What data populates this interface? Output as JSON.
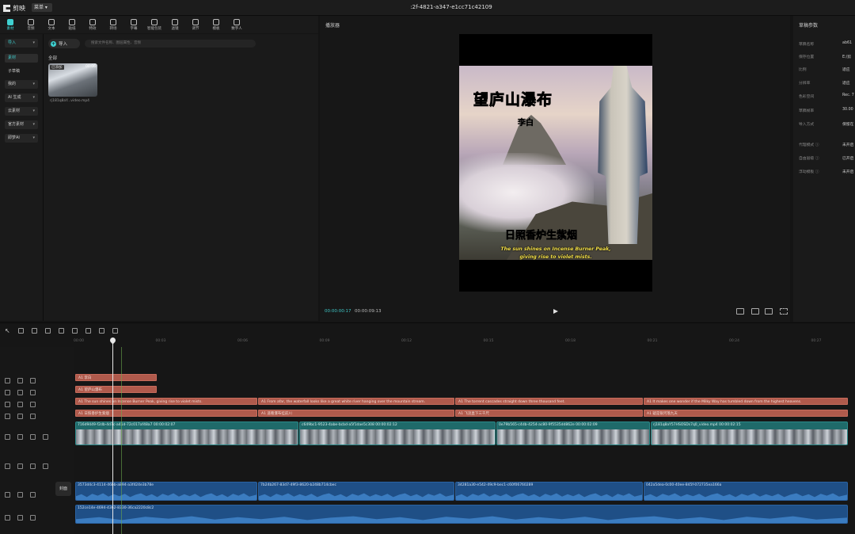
{
  "app": {
    "name": "剪映",
    "menu_label": "菜单",
    "doc_title": ":2f-4821-a347-e1cc71c42109"
  },
  "toolbar": {
    "items": [
      {
        "label": "素材",
        "icon": "media-icon"
      },
      {
        "label": "音频",
        "icon": "audio-icon"
      },
      {
        "label": "文本",
        "icon": "text-icon"
      },
      {
        "label": "贴纸",
        "icon": "sticker-icon"
      },
      {
        "label": "特效",
        "icon": "effects-icon"
      },
      {
        "label": "转场",
        "icon": "transition-icon"
      },
      {
        "label": "字幕",
        "icon": "subtitle-icon"
      },
      {
        "label": "智能包装",
        "icon": "smart-pack-icon"
      },
      {
        "label": "滤镜",
        "icon": "filter-icon"
      },
      {
        "label": "调节",
        "icon": "adjust-icon"
      },
      {
        "label": "模板",
        "icon": "template-icon"
      },
      {
        "label": "数字人",
        "icon": "avatar-icon"
      }
    ]
  },
  "leftnav": {
    "items": [
      "导入",
      "素材",
      "子草稿",
      "我的",
      "AI 生成",
      "云素材",
      "官方素材",
      "即梦AI"
    ]
  },
  "media": {
    "import_label": "导入",
    "search_placeholder": "搜索文件名称、图层属性、音频",
    "all_label": "全部",
    "thumb_tag": "已添加",
    "thumb_duration": "00:06",
    "thumb_name": "rj181q8aY...video.mp4"
  },
  "player": {
    "title": "播放器",
    "timecode": "00:00:00:17",
    "duration": "00:00:09:13",
    "title_cn": "望庐山瀑布",
    "author_cn": "李白",
    "subtitle_cn": "日照香炉生紫烟",
    "subtitle_en_1": "The sun shines on Incense Burner Peak,",
    "subtitle_en_2": "giving rise to violet mists."
  },
  "props": {
    "title": "草稿参数",
    "rows": [
      {
        "label": "草稿名称",
        "value": "ab61"
      },
      {
        "label": "保存位置",
        "value": "E:/剪"
      },
      {
        "label": "比例",
        "value": "适应"
      },
      {
        "label": "分辨率",
        "value": "适应"
      },
      {
        "label": "色彩空间",
        "value": "Rec. 7"
      },
      {
        "label": "草稿帧率",
        "value": "30.00"
      },
      {
        "label": "导入方式",
        "value": "保留在"
      },
      {
        "label": "代理模式 ⓘ",
        "value": "未开启"
      },
      {
        "label": "自由层级 ⓘ",
        "value": "已开启"
      },
      {
        "label": "浮动模板 ⓘ",
        "value": "未开启"
      }
    ]
  },
  "timeline": {
    "ticks": [
      "00:00",
      "00:03",
      "00:06",
      "00:09",
      "00:12",
      "00:15",
      "00:18",
      "00:21",
      "00:24",
      "00:27"
    ],
    "cover_label": "封面",
    "text_track_1": [
      {
        "label": "A1 李白"
      }
    ],
    "text_track_2": [
      {
        "label": "A1 望庐山瀑布"
      }
    ],
    "text_track_3": [
      {
        "label": "A1 The sun shines on Incense Burner Peak, giving rise to violet mists."
      },
      {
        "label": "A1 From afar, the waterfall looks like a great white river hanging over the mountain stream."
      },
      {
        "label": "A1 The torrent cascades straight down three thousand feet."
      },
      {
        "label": "A1 It makes one wonder if the Milky Way has tumbled down from the highest heavens."
      }
    ],
    "text_track_4": [
      {
        "label": "A1 日照香炉生紫烟"
      },
      {
        "label": "A1 遥看瀑布挂前川"
      },
      {
        "label": "A1 飞流直下三千尺"
      },
      {
        "label": "A1 疑是银河落九天"
      }
    ],
    "video_clips": [
      {
        "label": "716d9449-f2db-4d7c-a41d-72c017af48a7  00:00:02:07"
      },
      {
        "label": "c649bc1-9523-4abe-bcbd-a5f1dae5c308  00:00:02:12"
      },
      {
        "label": "0e79b565-c4db-4254-ac80-9f5535dd862e  00:00:02:09"
      },
      {
        "label": "rj181q8aY57HSOSDs7q0_video.mp4  00:00:02:15"
      }
    ],
    "audio_track_1": [
      {
        "label": "3573d4c3-4114-46bb-a894-a3f424e3b78e"
      },
      {
        "label": "7b24b267-83d7-49f3-8620-b248b714cbec"
      },
      {
        "label": "34281a30-e542-49c9-bec1-c60f06760289"
      },
      {
        "label": "042a5dea-0c00-40ee-845f-072735ea166a"
      }
    ],
    "audio_track_2": [
      {
        "label": "152ce14e-4694-4362-8330-36ca2220c8c2"
      }
    ]
  }
}
